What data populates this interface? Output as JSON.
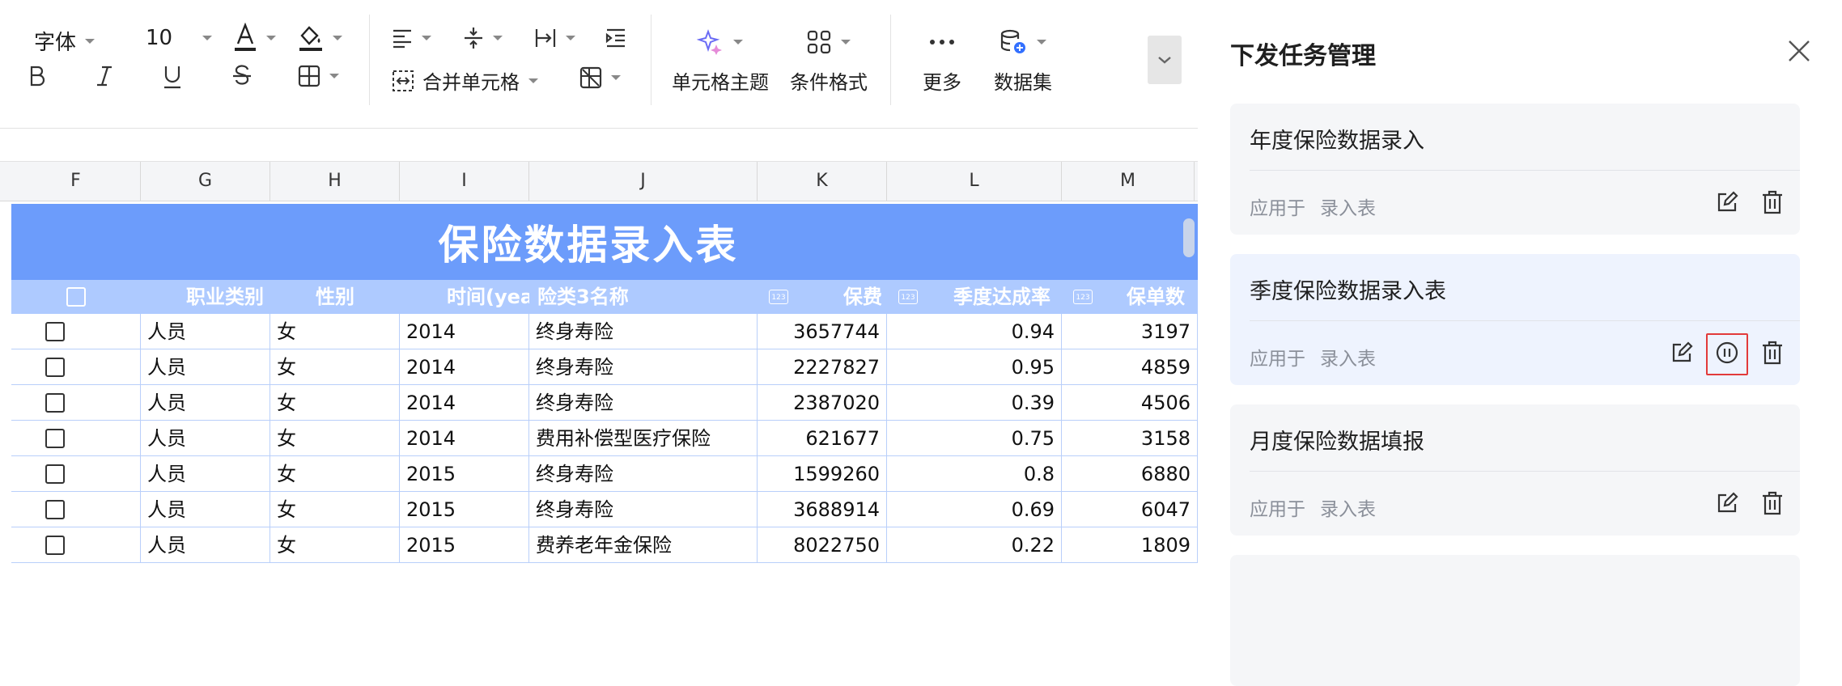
{
  "toolbar": {
    "font_name": "字体",
    "font_size": "10",
    "merge_cells_label": "合并单元格",
    "cell_theme_label": "单元格主题",
    "conditional_format_label": "条件格式",
    "more_label": "更多",
    "dataset_label": "数据集",
    "accent_color": "#e58bd8"
  },
  "columns": [
    "F",
    "G",
    "H",
    "I",
    "J",
    "K",
    "L",
    "M"
  ],
  "sheet": {
    "title": "保险数据录入表",
    "title_bg": "#6c9cfb",
    "header_bg": "#aecaff",
    "headers": {
      "occupation": "职业类别",
      "gender": "性别",
      "time": "时间(yea",
      "category": "险类3名称",
      "premium": "保费",
      "quarter_rate": "季度达成率",
      "policy_count": "保单数"
    },
    "rows": [
      {
        "occupation": "人员",
        "gender": "女",
        "year": "2014",
        "category": "终身寿险",
        "premium": "3657744",
        "rate": "0.94",
        "count": "3197"
      },
      {
        "occupation": "人员",
        "gender": "女",
        "year": "2014",
        "category": "终身寿险",
        "premium": "2227827",
        "rate": "0.95",
        "count": "4859"
      },
      {
        "occupation": "人员",
        "gender": "女",
        "year": "2014",
        "category": "终身寿险",
        "premium": "2387020",
        "rate": "0.39",
        "count": "4506"
      },
      {
        "occupation": "人员",
        "gender": "女",
        "year": "2014",
        "category": "费用补偿型医疗保险",
        "premium": "621677",
        "rate": "0.75",
        "count": "3158"
      },
      {
        "occupation": "人员",
        "gender": "女",
        "year": "2015",
        "category": "终身寿险",
        "premium": "1599260",
        "rate": "0.8",
        "count": "6880"
      },
      {
        "occupation": "人员",
        "gender": "女",
        "year": "2015",
        "category": "终身寿险",
        "premium": "3688914",
        "rate": "0.69",
        "count": "6047"
      },
      {
        "occupation": "人员",
        "gender": "女",
        "year": "2015",
        "category": "费养老年金保险",
        "premium": "8022750",
        "rate": "0.22",
        "count": "1809"
      }
    ]
  },
  "panel": {
    "title": "下发任务管理",
    "apply_label": "应用于",
    "tasks": [
      {
        "name": "年度保险数据录入",
        "target": "录入表"
      },
      {
        "name": "季度保险数据录入表",
        "target": "录入表"
      },
      {
        "name": "月度保险数据填报",
        "target": "录入表"
      }
    ],
    "highlight_color": "#e23a3a"
  }
}
